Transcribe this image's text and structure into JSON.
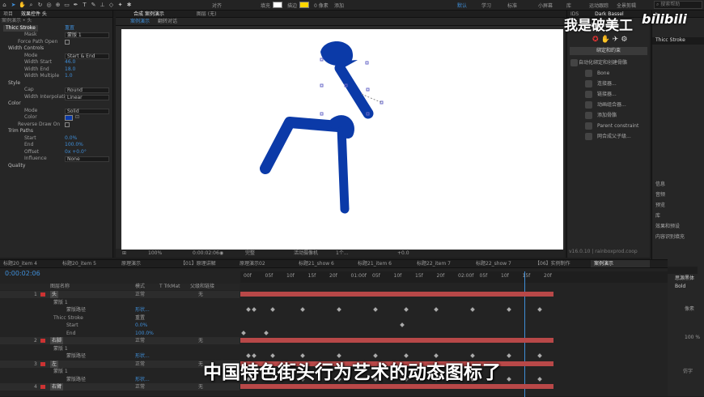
{
  "topbar": {
    "align_label": "对齐",
    "fill_label": "填充",
    "stroke_label": "描边",
    "stroke_width": "0 像素",
    "add_label": "添加",
    "workspaces": [
      "默认",
      "学习",
      "标准",
      "小屏幕",
      "库",
      "",
      "运动跟踪",
      "全景剪辑"
    ],
    "search_placeholder": "搜索帮助"
  },
  "left_panel": {
    "tabs": [
      "项目",
      "效果控件 头"
    ],
    "header": "案例演示 • 头",
    "effect_name": "Thicc Stroke",
    "reset_label": "重置",
    "rows": [
      {
        "label": "Mask",
        "value": "蒙版 1",
        "kind": "dd"
      },
      {
        "label": "Force Path Open",
        "value": "",
        "kind": "check"
      },
      {
        "label": "Width Controls",
        "value": "",
        "kind": "group"
      },
      {
        "label": "Mode",
        "value": "Start & End",
        "kind": "dd"
      },
      {
        "label": "Width Start",
        "value": "46.0",
        "kind": "num"
      },
      {
        "label": "Width End",
        "value": "18.0",
        "kind": "num"
      },
      {
        "label": "Width Multiple",
        "value": "1.0",
        "kind": "num"
      },
      {
        "label": "Style",
        "value": "",
        "kind": "group"
      },
      {
        "label": "Cap",
        "value": "Round",
        "kind": "dd"
      },
      {
        "label": "Width Interpolation",
        "value": "Linear",
        "kind": "dd"
      },
      {
        "label": "Color",
        "value": "",
        "kind": "group"
      },
      {
        "label": "Mode",
        "value": "Solid",
        "kind": "dd"
      },
      {
        "label": "Color",
        "value": "",
        "kind": "swatch"
      },
      {
        "label": "Reverse Draw On",
        "value": "",
        "kind": "check"
      },
      {
        "label": "Trim Paths",
        "value": "",
        "kind": "group"
      },
      {
        "label": "Start",
        "value": "0.0%",
        "kind": "num"
      },
      {
        "label": "End",
        "value": "100.0%",
        "kind": "num"
      },
      {
        "label": "Offset",
        "value": "0x +0.0°",
        "kind": "num"
      },
      {
        "label": "Influence",
        "value": "None",
        "kind": "dd"
      },
      {
        "label": "Quality",
        "value": "",
        "kind": "group"
      }
    ],
    "stroke_color": "#0b3aa8"
  },
  "viewer": {
    "tabs": [
      "合成 案例演示",
      "图层 (无)"
    ],
    "breadcrumbs": [
      "案例演示",
      "翻转对话"
    ],
    "zoom": "100%",
    "timecode": "0:00:02:06",
    "quality": "完整",
    "camera": "活动摄像机",
    "views": "1个...",
    "exposure": "+0.0"
  },
  "right_panel": {
    "workspace": "Dark Bassel",
    "duik_title": "Duik Bassel",
    "section": "绑定和约束",
    "commands": [
      "自动化绑定和创建骨骼",
      "Bone",
      "连接器...",
      "链接器...",
      "动画组合器...",
      "添加骨骼",
      "Parent constraint",
      "网合成父子级..."
    ],
    "version": "v16.0.10 | rainboxprod.coop"
  },
  "far_right": {
    "layer_label": "Thicc Stroke",
    "panels": [
      "信息",
      "音频",
      "预览",
      "库",
      "效果和预设",
      "内容识别填充",
      "段落",
      "字符"
    ],
    "font_name": "思源黑体",
    "font_style": "Bold",
    "px_label": "像素",
    "pct_label": "100 %",
    "faux_label": "仿字"
  },
  "timeline": {
    "comp_tabs": [
      "标题20_item 4",
      "标题20_item 5",
      "原理演示",
      "【01】原理讲解",
      "原理演示02",
      "标题21_show 6",
      "标题21_item 6",
      "标题22_item 7",
      "标题22_show 7",
      "【06】实例制作",
      "案例演示"
    ],
    "timecode": "0:00:02:06",
    "col_headers": [
      "图层名称",
      "模式",
      "T TrkMat",
      "父级和链接"
    ],
    "ruler_marks": [
      "00f",
      "05f",
      "10f",
      "15f",
      "20f",
      "01:00f",
      "05f",
      "10f",
      "15f",
      "20f",
      "02:00f",
      "05f",
      "10f",
      "15f",
      "20f"
    ],
    "layers": [
      {
        "num": "1",
        "name": "头",
        "mode": "正常",
        "parent": "无",
        "kind": "layer"
      },
      {
        "num": "",
        "name": "蒙版 1",
        "mode": "",
        "parent": "",
        "kind": "sub"
      },
      {
        "num": "",
        "name": "蒙版路径",
        "mode": "形状...",
        "parent": "",
        "kind": "prop"
      },
      {
        "num": "",
        "name": "Thicc Stroke",
        "mode": "重置",
        "parent": "",
        "kind": "sub"
      },
      {
        "num": "",
        "name": "Start",
        "mode": "0.0%",
        "parent": "",
        "kind": "prop"
      },
      {
        "num": "",
        "name": "End",
        "mode": "100.0%",
        "parent": "",
        "kind": "prop"
      },
      {
        "num": "2",
        "name": "右脚",
        "mode": "正常",
        "parent": "无",
        "kind": "layer"
      },
      {
        "num": "",
        "name": "蒙版 1",
        "mode": "",
        "parent": "",
        "kind": "sub"
      },
      {
        "num": "",
        "name": "蒙版路径",
        "mode": "形状...",
        "parent": "",
        "kind": "prop"
      },
      {
        "num": "3",
        "name": "左",
        "mode": "正常",
        "parent": "无",
        "kind": "layer"
      },
      {
        "num": "",
        "name": "蒙版 1",
        "mode": "",
        "parent": "",
        "kind": "sub"
      },
      {
        "num": "",
        "name": "蒙版路径",
        "mode": "形状...",
        "parent": "",
        "kind": "prop"
      },
      {
        "num": "4",
        "name": "右臂",
        "mode": "正常",
        "parent": "无",
        "kind": "layer"
      }
    ]
  },
  "overlay": {
    "watermark": "我是破美工",
    "bilibili": "bilibili",
    "subtitle": "中国特色街头行为艺术的动态图标了"
  }
}
